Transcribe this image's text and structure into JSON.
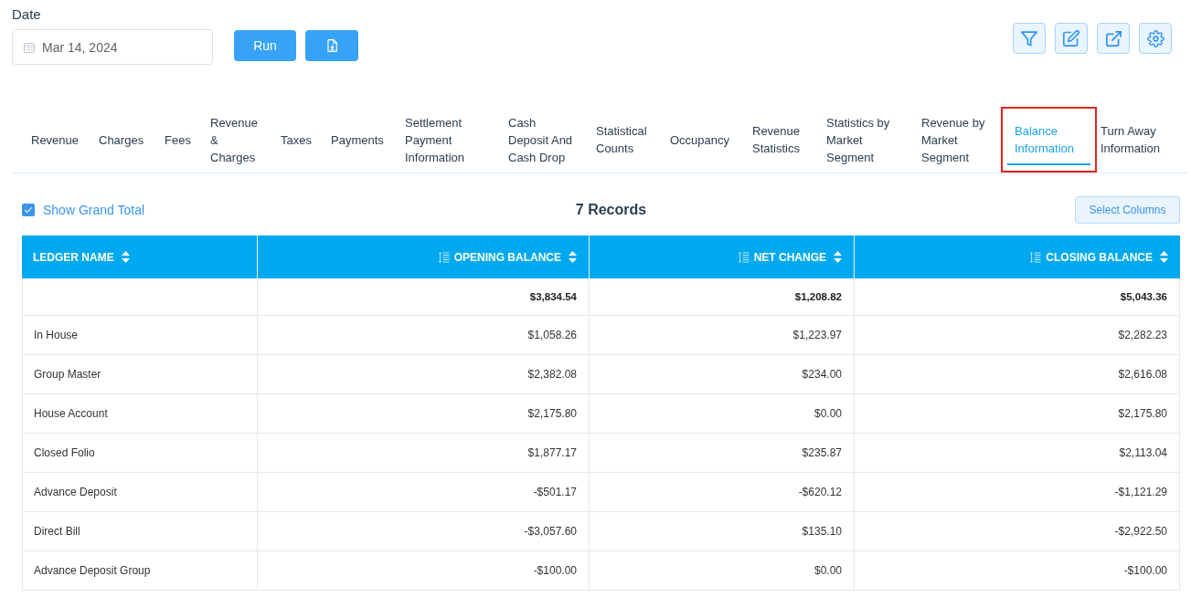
{
  "date_filter": {
    "label": "Date",
    "value": "Mar 14, 2024"
  },
  "actions": {
    "run": "Run"
  },
  "tabs": [
    {
      "label": "Revenue",
      "selected": false
    },
    {
      "label": "Charges",
      "selected": false
    },
    {
      "label": "Fees",
      "selected": false
    },
    {
      "label": "Revenue & Charges",
      "selected": false
    },
    {
      "label": "Taxes",
      "selected": false
    },
    {
      "label": "Payments",
      "selected": false
    },
    {
      "label": "Settlement Payment Information",
      "selected": false
    },
    {
      "label": "Cash Deposit And Cash Drop",
      "selected": false
    },
    {
      "label": "Statistical Counts",
      "selected": false
    },
    {
      "label": "Occupancy",
      "selected": false
    },
    {
      "label": "Revenue Statistics",
      "selected": false
    },
    {
      "label": "Statistics by Market Segment",
      "selected": false
    },
    {
      "label": "Revenue by Market Segment",
      "selected": false
    },
    {
      "label": "Balance Information",
      "selected": true
    },
    {
      "label": "Turn Away Information",
      "selected": false
    }
  ],
  "show_grand_total": {
    "label": "Show Grand Total",
    "checked": true
  },
  "records": "7 Records",
  "select_columns": "Select Columns",
  "table": {
    "columns": [
      {
        "label": "LEDGER NAME",
        "kind": "text"
      },
      {
        "label": "OPENING BALANCE",
        "kind": "amount"
      },
      {
        "label": "NET CHANGE",
        "kind": "amount"
      },
      {
        "label": "CLOSING BALANCE",
        "kind": "amount"
      }
    ],
    "grand_total": [
      "$3,834.54",
      "$1,208.82",
      "$5,043.36"
    ],
    "rows": [
      [
        "In House",
        "$1,058.26",
        "$1,223.97",
        "$2,282.23"
      ],
      [
        "Group Master",
        "$2,382.08",
        "$234.00",
        "$2,616.08"
      ],
      [
        "House Account",
        "$2,175.80",
        "$0.00",
        "$2,175.80"
      ],
      [
        "Closed Folio",
        "$1,877.17",
        "$235.87",
        "$2,113.04"
      ],
      [
        "Advance Deposit",
        "-$501.17",
        "-$620.12",
        "-$1,121.29"
      ],
      [
        "Direct Bill",
        "-$3,057.60",
        "$135.10",
        "-$2,922.50"
      ],
      [
        "Advance Deposit Group",
        "-$100.00",
        "$0.00",
        "-$100.00"
      ]
    ]
  }
}
